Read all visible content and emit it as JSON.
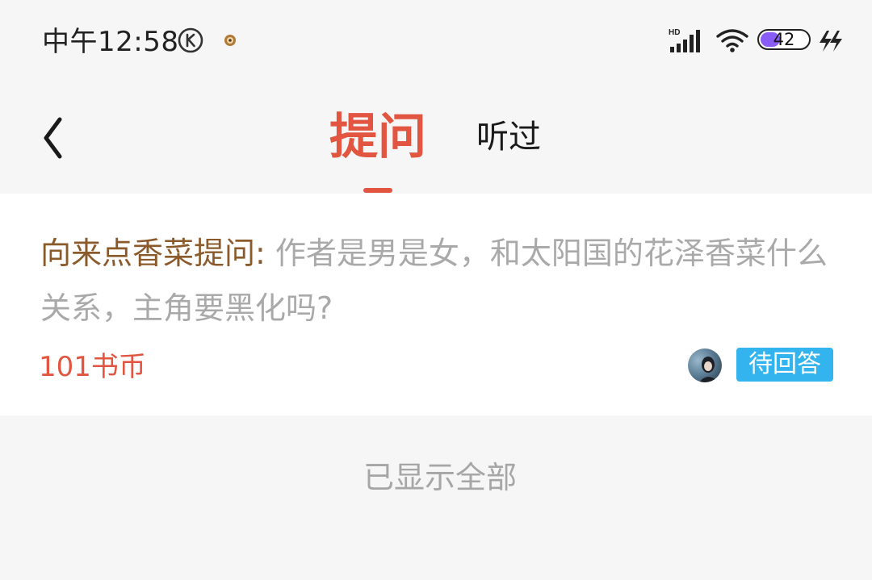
{
  "status_bar": {
    "time": "中午12:58",
    "battery_level": "42",
    "battery_fraction": 0.42,
    "icons": [
      "k-circle-icon",
      "notification-icon",
      "hd-signal-icon",
      "wifi-icon",
      "battery-icon",
      "charging-icon"
    ],
    "network_label": "HD"
  },
  "nav": {
    "back_icon": "chevron-left-icon",
    "tabs": [
      {
        "label": "提问",
        "active": true
      },
      {
        "label": "听过",
        "active": false
      }
    ]
  },
  "question_card": {
    "asker": "向来点香菜提问:",
    "question": " 作者是男是女，和太阳国的花泽香菜什么关系，主角要黑化吗?",
    "price": "101书币",
    "status": "待回答",
    "avatar_icon": "user-avatar"
  },
  "footer": {
    "end_text": "已显示全部"
  },
  "colors": {
    "accent": "#e25540",
    "asker": "#8b5a2b",
    "badge": "#33b4ee",
    "muted_text": "#a9a9a9",
    "background": "#f6f6f6",
    "battery_fill": "#8a5cf6"
  }
}
